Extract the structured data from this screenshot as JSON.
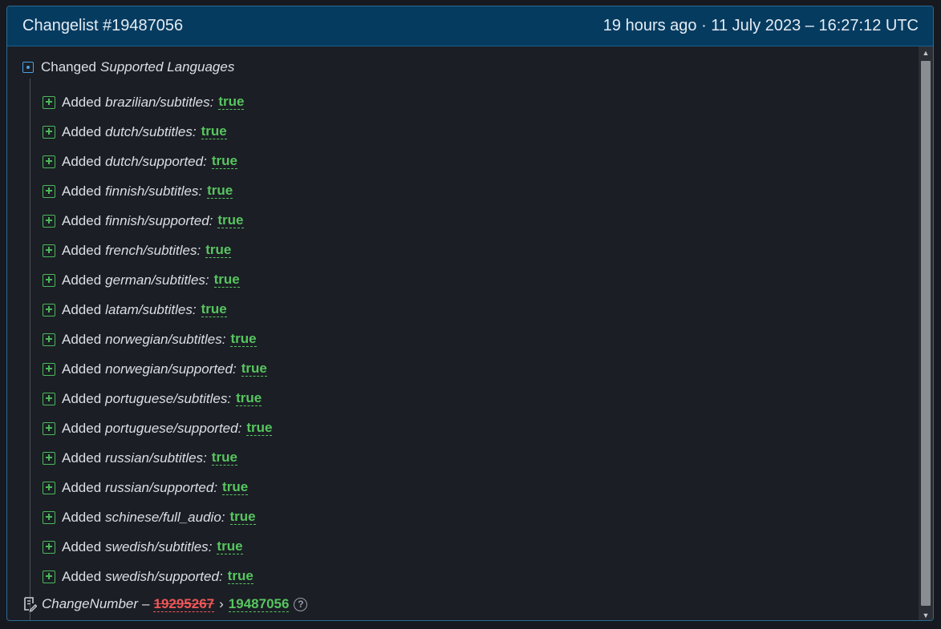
{
  "header": {
    "title": "Changelist #19487056",
    "timestamp": "19 hours ago · 11 July 2023 – 16:27:12 UTC"
  },
  "root": {
    "verb": "Changed",
    "key": "Supported Languages"
  },
  "items": [
    {
      "verb": "Added",
      "key": "brazilian/subtitles",
      "value": "true"
    },
    {
      "verb": "Added",
      "key": "dutch/subtitles",
      "value": "true"
    },
    {
      "verb": "Added",
      "key": "dutch/supported",
      "value": "true"
    },
    {
      "verb": "Added",
      "key": "finnish/subtitles",
      "value": "true"
    },
    {
      "verb": "Added",
      "key": "finnish/supported",
      "value": "true"
    },
    {
      "verb": "Added",
      "key": "french/subtitles",
      "value": "true"
    },
    {
      "verb": "Added",
      "key": "german/subtitles",
      "value": "true"
    },
    {
      "verb": "Added",
      "key": "latam/subtitles",
      "value": "true"
    },
    {
      "verb": "Added",
      "key": "norwegian/subtitles",
      "value": "true"
    },
    {
      "verb": "Added",
      "key": "norwegian/supported",
      "value": "true"
    },
    {
      "verb": "Added",
      "key": "portuguese/subtitles",
      "value": "true"
    },
    {
      "verb": "Added",
      "key": "portuguese/supported",
      "value": "true"
    },
    {
      "verb": "Added",
      "key": "russian/subtitles",
      "value": "true"
    },
    {
      "verb": "Added",
      "key": "russian/supported",
      "value": "true"
    },
    {
      "verb": "Added",
      "key": "schinese/full_audio",
      "value": "true"
    },
    {
      "verb": "Added",
      "key": "swedish/subtitles",
      "value": "true"
    },
    {
      "verb": "Added",
      "key": "swedish/supported",
      "value": "true"
    }
  ],
  "footer": {
    "key": "ChangeNumber",
    "dash": "–",
    "old_value": "19295267",
    "arrow": "›",
    "new_value": "19487056",
    "help_glyph": "?"
  },
  "icons": {
    "root": "collapse-box-icon",
    "item": "plus-box-icon",
    "footer": "note-edit-icon",
    "help": "help-circle-icon"
  },
  "colors": {
    "header_bg": "#063b60",
    "added": "#57c55f",
    "removed": "#ef5757",
    "accent": "#4aa3e3"
  }
}
